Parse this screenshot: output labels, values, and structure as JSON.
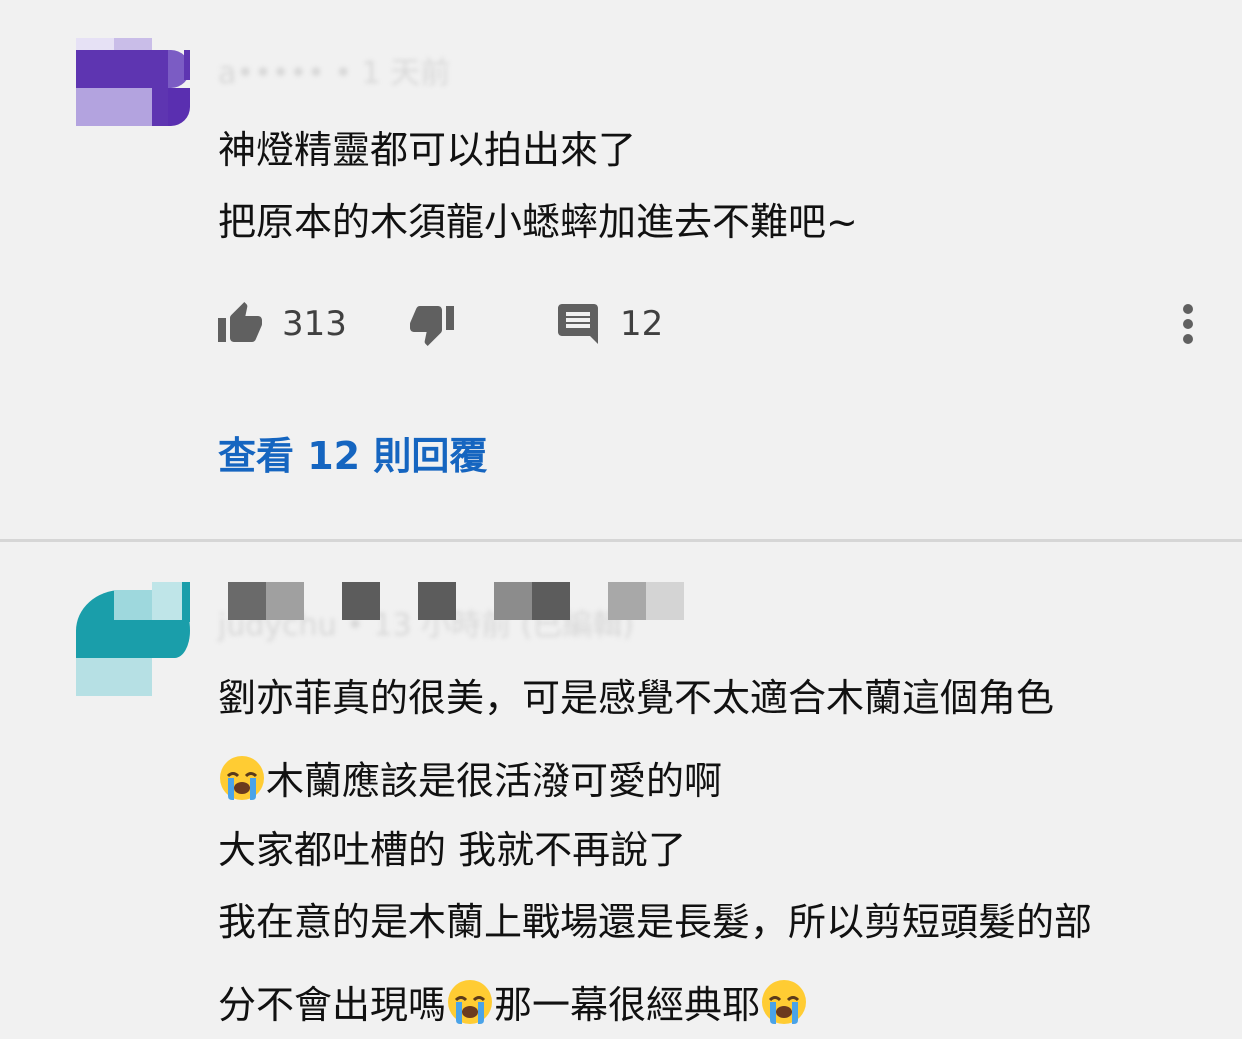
{
  "comments": [
    {
      "author": "a••••• • 1 天前",
      "lines": [
        "神燈精靈都可以拍出來了",
        "把原本的木須龍小蟋蟀加進去不難吧~"
      ],
      "likes": "313",
      "replies": "12",
      "view_replies": "查看 12 則回覆"
    },
    {
      "author": "judychu • 13 小時前 (已編輯)",
      "line1": "劉亦菲真的很美，可是感覺不太適合木蘭這個角色",
      "line2": "木蘭應該是很活潑可愛的啊",
      "line3": "大家都吐槽的 我就不再說了",
      "line4": "我在意的是木蘭上戰場還是長髮，所以剪短頭髮的部",
      "line5a": "分不會出現嗎",
      "line5b": "那一幕很經典耶"
    }
  ],
  "icons": {
    "like": "thumbs-up-icon",
    "dislike": "thumbs-down-icon",
    "reply": "comment-icon",
    "more": "more-vert-icon",
    "emoji": "crying-face-emoji"
  },
  "colors": {
    "link": "#1565c0",
    "background": "#f1f1f1"
  }
}
